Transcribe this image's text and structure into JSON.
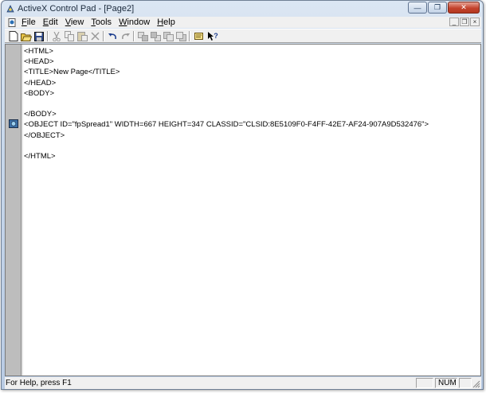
{
  "window": {
    "title": "ActiveX Control Pad - [Page2]"
  },
  "menu": {
    "items": [
      {
        "label": "File",
        "accel": "F",
        "rest": "ile"
      },
      {
        "label": "Edit",
        "accel": "E",
        "rest": "dit"
      },
      {
        "label": "View",
        "accel": "V",
        "rest": "iew"
      },
      {
        "label": "Tools",
        "accel": "T",
        "rest": "ools"
      },
      {
        "label": "Window",
        "accel": "W",
        "rest": "indow"
      },
      {
        "label": "Help",
        "accel": "H",
        "rest": "elp"
      }
    ]
  },
  "toolbar": {
    "buttons": [
      "new",
      "open",
      "save",
      "cut",
      "copy",
      "paste",
      "delete",
      "undo",
      "redo",
      "bring-to-front",
      "send-to-back",
      "bring-forward",
      "send-backward",
      "script-wizard",
      "help-context"
    ]
  },
  "editor": {
    "lines": [
      "<HTML>",
      "<HEAD>",
      "<TITLE>New Page</TITLE>",
      "</HEAD>",
      "<BODY>",
      "",
      "</BODY>",
      "<OBJECT ID=\"fpSpread1\" WIDTH=667 HEIGHT=347 CLASSID=\"CLSID:8E5109F0-F4FF-42E7-AF24-907A9D532476\">",
      "</OBJECT>",
      "",
      "</HTML>"
    ]
  },
  "status": {
    "help_text": "For Help, press F1",
    "num": "NUM"
  }
}
